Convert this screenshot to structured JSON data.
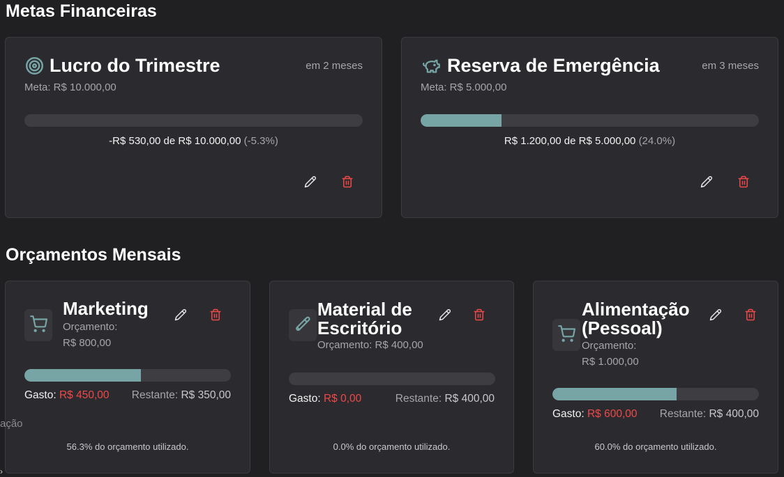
{
  "goals_section": {
    "title": "Metas Financeiras"
  },
  "goals": [
    {
      "icon": "target-icon",
      "title": "Lucro do Trimestre",
      "due": "em 2 meses",
      "meta": "Meta: R$ 10.000,00",
      "progress_fraction": 0,
      "current_text": "-R$ 530,00 de R$ 10.000,00",
      "percent_text": "(-5.3%)"
    },
    {
      "icon": "piggy-bank-icon",
      "title": "Reserva de Emergência",
      "due": "em 3 meses",
      "meta": "Meta: R$ 5.000,00",
      "progress_fraction": 0.24,
      "current_text": "R$ 1.200,00 de R$ 5.000,00",
      "percent_text": "(24.0%)"
    }
  ],
  "budgets_section": {
    "title": "Orçamentos Mensais"
  },
  "budgets": [
    {
      "icon": "shopping-cart-icon",
      "title_line1": "Marketing",
      "title_line2": "",
      "amount_line1": "Orçamento:",
      "amount_line2": "R$ 800,00",
      "progress_fraction": 0.563,
      "spent_label": "Gasto:",
      "spent_value": "R$ 450,00",
      "remaining_label": "Restante:",
      "remaining_value": "R$ 350,00",
      "used_note": "56.3% do orçamento utilizado."
    },
    {
      "icon": "paintbrush-icon",
      "title_line1": "Material de",
      "title_line2": "Escritório",
      "amount_line1": "Orçamento: R$ 400,00",
      "amount_line2": "",
      "progress_fraction": 0,
      "spent_label": "Gasto:",
      "spent_value": "R$ 0,00",
      "remaining_label": "Restante:",
      "remaining_value": "R$ 400,00",
      "used_note": "0.0% do orçamento utilizado."
    },
    {
      "icon": "shopping-cart-icon",
      "title_line1": "Alimentação",
      "title_line2": "(Pessoal)",
      "amount_line1": "Orçamento:",
      "amount_line2": "R$ 1.000,00",
      "progress_fraction": 0.6,
      "spent_label": "Gasto:",
      "spent_value": "R$ 600,00",
      "remaining_label": "Restante:",
      "remaining_value": "R$ 400,00",
      "used_note": "60.0% do orçamento utilizado."
    }
  ],
  "stray": {
    "text": "ação",
    "cursor": "›"
  },
  "colors": {
    "accent": "#77a5a5",
    "danger": "#ef4848",
    "card_bg": "#2b2b2f",
    "page_bg": "#202023"
  }
}
